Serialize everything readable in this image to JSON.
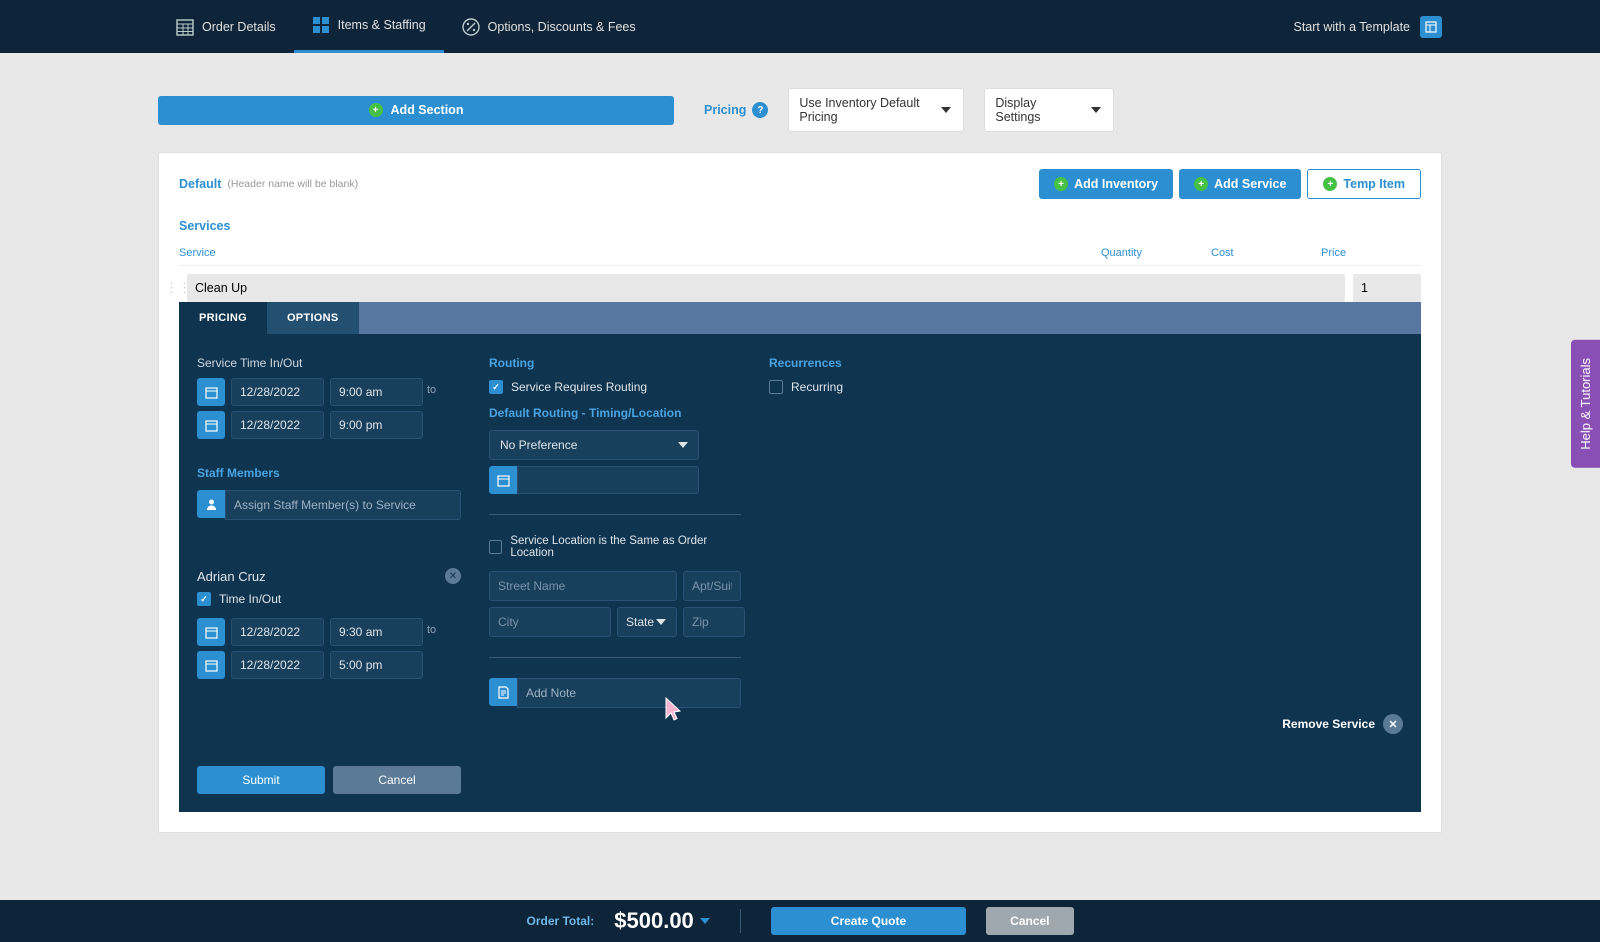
{
  "nav": {
    "order_details": "Order Details",
    "items_staffing": "Items & Staffing",
    "options_discounts": "Options, Discounts & Fees",
    "start_template": "Start with a Template"
  },
  "controls": {
    "add_section": "Add Section",
    "pricing_label": "Pricing",
    "pricing_select": "Use Inventory Default Pricing",
    "display_settings": "Display Settings"
  },
  "header": {
    "title": "Default",
    "note": "(Header name will be blank)",
    "add_inventory": "Add Inventory",
    "add_service": "Add Service",
    "temp_item": "Temp Item"
  },
  "services": {
    "title": "Services",
    "columns": {
      "service": "Service",
      "quantity": "Quantity",
      "cost": "Cost",
      "price": "Price"
    },
    "row": {
      "name": "Clean Up",
      "qty": "1"
    }
  },
  "tabs": {
    "pricing": "PRICING",
    "options": "OPTIONS"
  },
  "options": {
    "service_time": "Service Time In/Out",
    "date_in": "12/28/2022",
    "time_in": "9:00 am",
    "date_out": "12/28/2022",
    "time_out": "9:00 pm",
    "to": "to",
    "staff_members": "Staff Members",
    "assign_placeholder": "Assign Staff Member(s) to Service",
    "staff_name": "Adrian Cruz",
    "time_in_out": "Time In/Out",
    "s_date_in": "12/28/2022",
    "s_time_in": "9:30 am",
    "s_date_out": "12/28/2022",
    "s_time_out": "5:00 pm",
    "submit": "Submit",
    "cancel": "Cancel",
    "routing": "Routing",
    "requires_routing": "Service Requires Routing",
    "default_routing": "Default Routing - Timing/Location",
    "no_preference": "No Preference",
    "same_location": "Service Location is the Same as Order Location",
    "street_ph": "Street Name",
    "apt_ph": "Apt/Suite",
    "city_ph": "City",
    "state_ph": "State",
    "zip_ph": "Zip",
    "add_note_ph": "Add Note",
    "recurrences": "Recurrences",
    "recurring": "Recurring",
    "remove_service": "Remove Service"
  },
  "footer": {
    "order_total": "Order Total:",
    "total_value": "$500.00",
    "create_quote": "Create Quote",
    "cancel": "Cancel"
  },
  "help": "Help & Tutorials"
}
